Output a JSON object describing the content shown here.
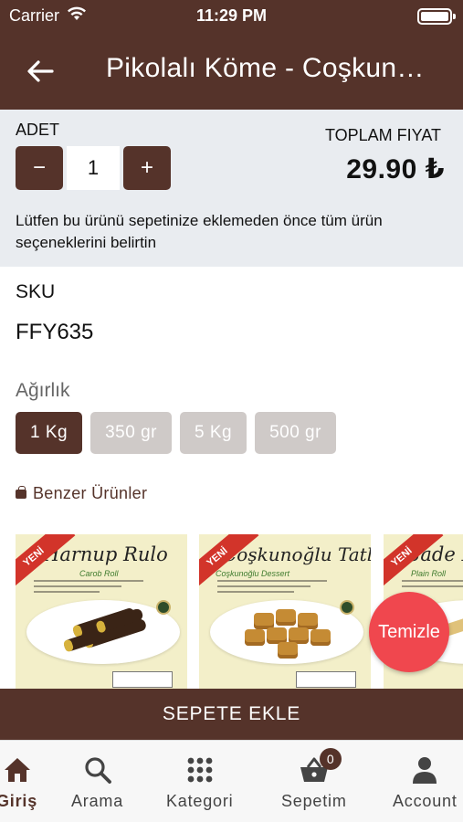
{
  "status_bar": {
    "carrier": "Carrier",
    "time": "11:29 PM"
  },
  "nav": {
    "title": "Pikolalı Köme - Coşkun…"
  },
  "quantity": {
    "label": "ADET",
    "minus": "−",
    "value": "1",
    "plus": "+",
    "total_label": "TOPLAM FIYAT",
    "total_price": "29.90 ₺",
    "notice": "Lütfen bu ürünü sepetinize eklemeden önce tüm ürün seçeneklerini belirtin"
  },
  "sku": {
    "label": "SKU",
    "value": "FFY635"
  },
  "weight": {
    "label": "Ağırlık",
    "options": [
      "1 Kg",
      "350 gr",
      "5 Kg",
      "500 gr"
    ],
    "selected": "1 Kg"
  },
  "similar": {
    "label": "Benzer Ürünler",
    "products": [
      {
        "badge": "YENİ",
        "name": "Harnup Rulo",
        "subtitle": "Carob Roll"
      },
      {
        "badge": "YENİ",
        "name": "Coşkunoğlu Tatlısı",
        "subtitle": "Coşkunoğlu Dessert"
      },
      {
        "badge": "YENİ",
        "name": "Sade Rulo",
        "subtitle": "Plain Roll"
      }
    ]
  },
  "fab": {
    "label": "Temizle"
  },
  "add_to_cart": {
    "label": "SEPETE EKLE"
  },
  "tabbar": {
    "items": [
      {
        "label": "Giriş",
        "icon": "home-icon",
        "active": true
      },
      {
        "label": "Arama",
        "icon": "search-icon"
      },
      {
        "label": "Kategori",
        "icon": "grid-icon"
      },
      {
        "label": "Sepetim",
        "icon": "basket-icon",
        "badge": "0"
      },
      {
        "label": "Account",
        "icon": "user-icon"
      }
    ]
  },
  "colors": {
    "brand": "#55332a",
    "panel": "#e9ecf0",
    "option_inactive": "#cfcac8",
    "fab": "#f0474e"
  }
}
